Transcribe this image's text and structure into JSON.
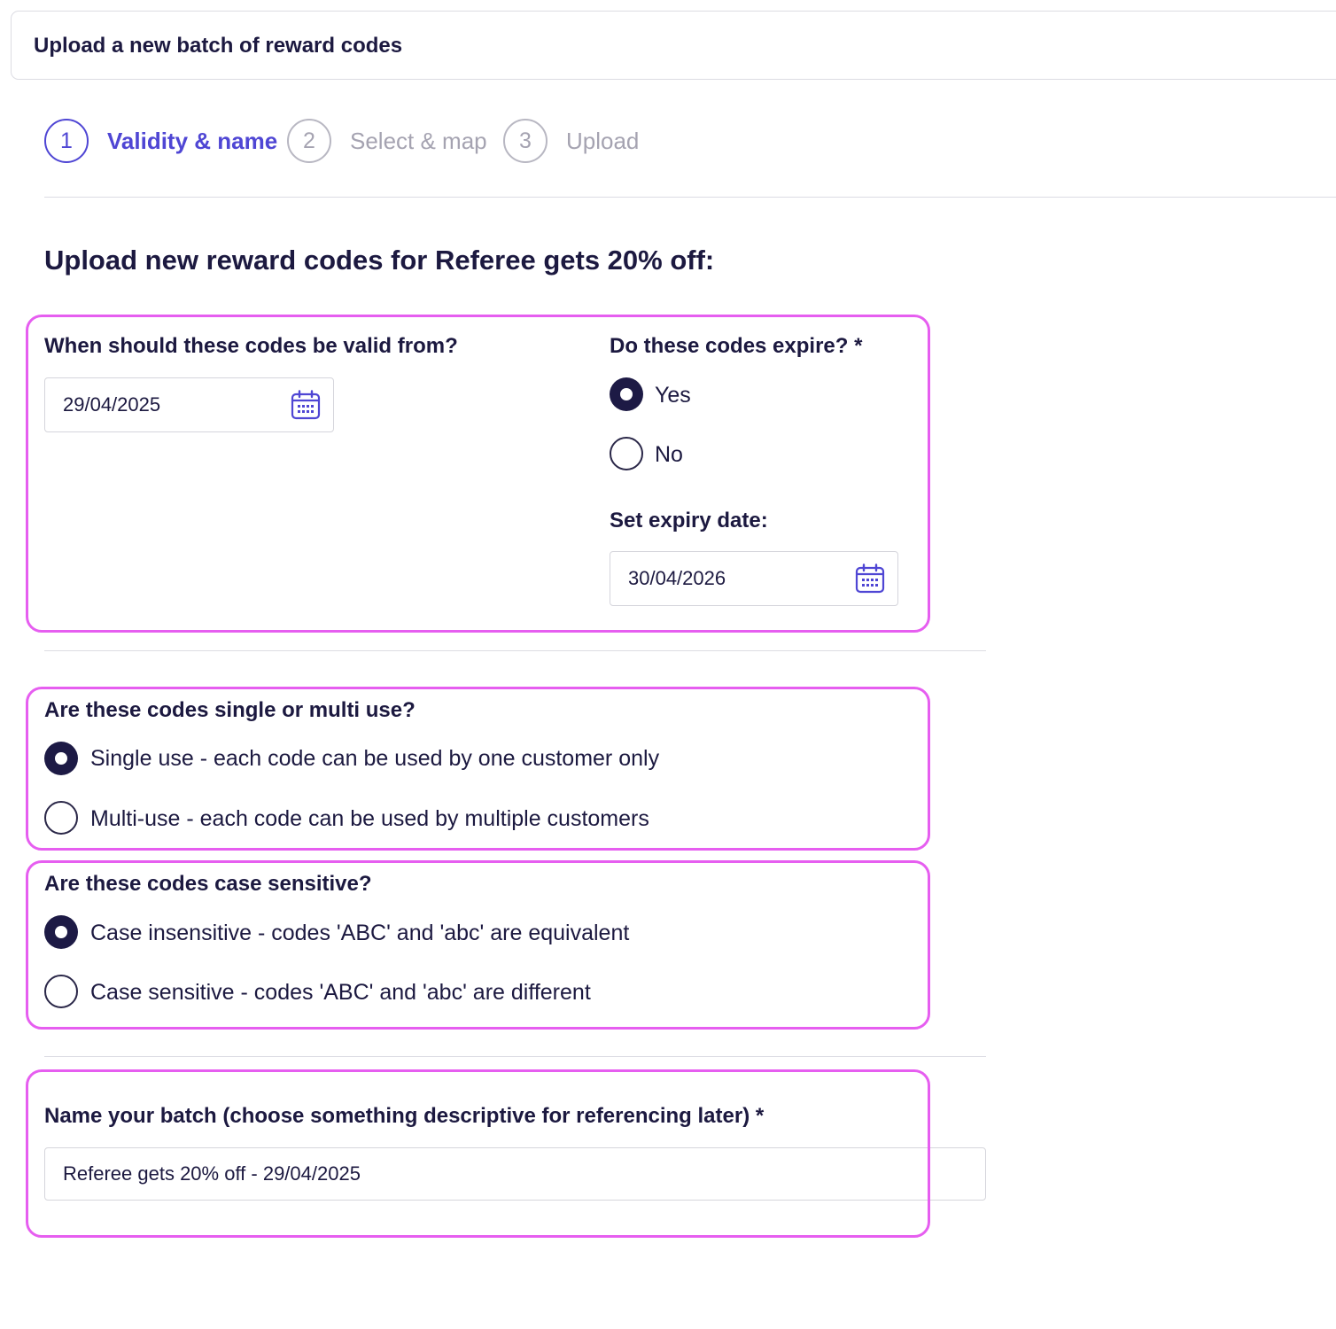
{
  "header": {
    "title": "Upload a new batch of reward codes"
  },
  "stepper": {
    "steps": [
      {
        "number": "1",
        "label": "Validity & name",
        "state": "active"
      },
      {
        "number": "2",
        "label": "Select & map",
        "state": "inactive"
      },
      {
        "number": "3",
        "label": "Upload",
        "state": "inactive"
      }
    ]
  },
  "page": {
    "heading": "Upload new reward codes for Referee gets 20% off:"
  },
  "validity": {
    "valid_from_label": "When should these codes be valid from?",
    "valid_from_value": "29/04/2025",
    "expire_label": "Do these codes expire? *",
    "expire_options": [
      {
        "label": "Yes",
        "checked": true
      },
      {
        "label": "No",
        "checked": false
      }
    ],
    "expiry_date_label": "Set expiry date:",
    "expiry_date_value": "30/04/2026"
  },
  "usage": {
    "label": "Are these codes single or multi use?",
    "options": [
      {
        "label": "Single use - each code can be used by one customer only",
        "checked": true
      },
      {
        "label": "Multi-use - each code can be used by multiple customers",
        "checked": false
      }
    ]
  },
  "case": {
    "label": "Are these codes case sensitive?",
    "options": [
      {
        "label": "Case insensitive - codes 'ABC' and 'abc' are equivalent",
        "checked": true
      },
      {
        "label": "Case sensitive - codes 'ABC' and 'abc' are different",
        "checked": false
      }
    ]
  },
  "batch_name": {
    "label": "Name your batch (choose something descriptive for referencing later) *",
    "value": "Referee gets 20% off - 29/04/2025"
  },
  "colors": {
    "accent": "#4f46d4",
    "highlight_border": "#e65ef0",
    "text_primary": "#1c1940",
    "text_muted": "#a5a3b1",
    "radio_checked": "#1d1a45"
  },
  "icons": {
    "date_picker": "calendar-icon"
  }
}
